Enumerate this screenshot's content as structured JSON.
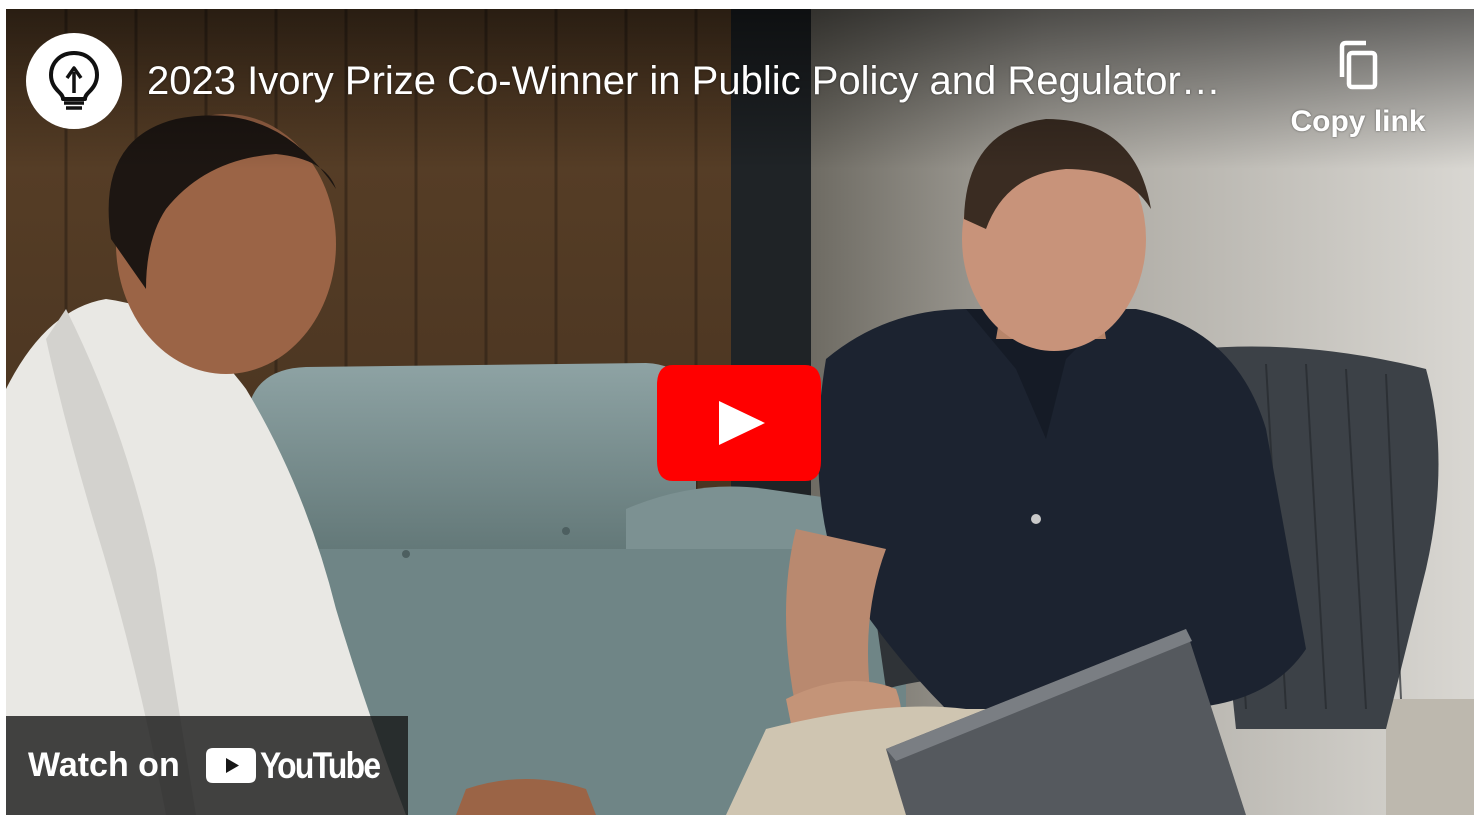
{
  "player": {
    "title": "2023 Ivory Prize Co-Winner in Public Policy and Regulator…",
    "channel_icon": "lightbulb-icon",
    "copy_link_label": "Copy link",
    "copy_icon": "copy-icon",
    "play_icon": "play-icon",
    "watch_on_label": "Watch on",
    "youtube_wordmark": "YouTube",
    "colors": {
      "play_red": "#ff0000",
      "overlay_text": "#ffffff",
      "watch_bar_bg": "#171717"
    }
  }
}
